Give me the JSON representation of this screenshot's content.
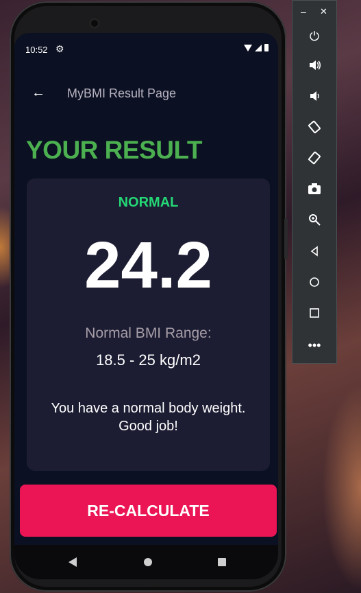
{
  "status_bar": {
    "time": "10:52"
  },
  "app_bar": {
    "title": "MyBMI Result Page"
  },
  "result": {
    "heading": "YOUR RESULT",
    "status_label": "NORMAL",
    "bmi_value": "24.2",
    "range_label": "Normal BMI Range:",
    "range_value": "18.5 - 25 kg/m2",
    "message": "You have a normal body weight. Good job!"
  },
  "button": {
    "label": "RE-CALCULATE"
  },
  "colors": {
    "accent_green": "#4caf50",
    "status_green": "#24d876",
    "button_pink": "#eb1555",
    "card_bg": "#1c1d33",
    "screen_bg": "#0b1022"
  },
  "emulator_panel": {
    "buttons": [
      "minimize-icon",
      "close-icon",
      "power-icon",
      "volume-up-icon",
      "volume-down-icon",
      "rotate-left-icon",
      "rotate-right-icon",
      "camera-icon",
      "zoom-icon",
      "back-icon",
      "home-icon",
      "overview-icon",
      "more-icon"
    ]
  }
}
